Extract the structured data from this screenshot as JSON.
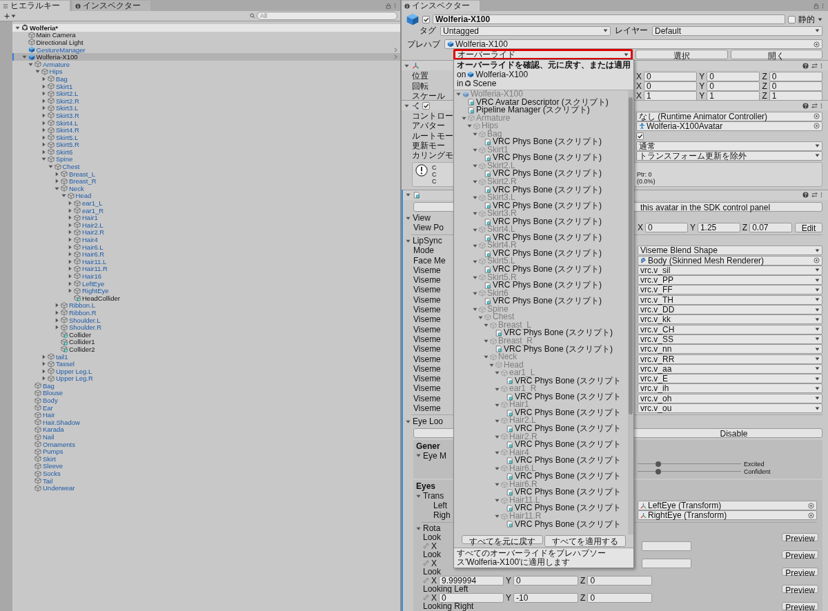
{
  "hierarchy": {
    "tabs": [
      {
        "label": "ヒエラルキー",
        "selected": true
      },
      {
        "label": "インスペクター",
        "selected": false
      }
    ],
    "add_button": "+",
    "search": {
      "placeholder": "All"
    },
    "tree": [
      {
        "name": "Wolferia*",
        "kind": "scene",
        "expanded": true,
        "selected": false,
        "children": [
          {
            "name": "Main Camera",
            "kind": "object",
            "selected": false
          },
          {
            "name": "Directional Light",
            "kind": "object",
            "selected": false
          },
          {
            "name": "GestureManager",
            "kind": "prefab",
            "selected": false
          },
          {
            "name": "Wolferia-X100",
            "kind": "prefab",
            "expanded": true,
            "selected": true,
            "children": [
              {
                "name": "Armature",
                "kind": "prefab-child",
                "expanded": true,
                "selected": false,
                "children": [
                  {
                    "name": "Hips",
                    "kind": "prefab-child",
                    "expanded": true,
                    "selected": false,
                    "children": [
                      {
                        "name": "Bag",
                        "kind": "prefab-child",
                        "expanded": false,
                        "selected": false
                      },
                      {
                        "name": "Skirt1",
                        "kind": "prefab-child",
                        "expanded": false,
                        "selected": false
                      },
                      {
                        "name": "Skirt2.L",
                        "kind": "prefab-child",
                        "expanded": false,
                        "selected": false
                      },
                      {
                        "name": "Skirt2.R",
                        "kind": "prefab-child",
                        "expanded": false,
                        "selected": false
                      },
                      {
                        "name": "Skirt3.L",
                        "kind": "prefab-child",
                        "expanded": false,
                        "selected": false
                      },
                      {
                        "name": "Skirt3.R",
                        "kind": "prefab-child",
                        "expanded": false,
                        "selected": false
                      },
                      {
                        "name": "Skirt4.L",
                        "kind": "prefab-child",
                        "expanded": false,
                        "selected": false
                      },
                      {
                        "name": "Skirt4.R",
                        "kind": "prefab-child",
                        "expanded": false,
                        "selected": false
                      },
                      {
                        "name": "Skirt5.L",
                        "kind": "prefab-child",
                        "expanded": false,
                        "selected": false
                      },
                      {
                        "name": "Skirt5.R",
                        "kind": "prefab-child",
                        "expanded": false,
                        "selected": false
                      },
                      {
                        "name": "Skirt6",
                        "kind": "prefab-child",
                        "expanded": false,
                        "selected": false
                      },
                      {
                        "name": "Spine",
                        "kind": "prefab-child",
                        "expanded": true,
                        "selected": false,
                        "children": [
                          {
                            "name": "Chest",
                            "kind": "prefab-child",
                            "expanded": true,
                            "selected": false,
                            "children": [
                              {
                                "name": "Breast_L",
                                "kind": "prefab-child",
                                "expanded": false,
                                "selected": false
                              },
                              {
                                "name": "Breast_R",
                                "kind": "prefab-child",
                                "expanded": false,
                                "selected": false
                              },
                              {
                                "name": "Neck",
                                "kind": "prefab-child",
                                "expanded": true,
                                "selected": false,
                                "children": [
                                  {
                                    "name": "Head",
                                    "kind": "prefab-child",
                                    "expanded": true,
                                    "selected": false,
                                    "children": [
                                      {
                                        "name": "ear1_L",
                                        "kind": "prefab-child",
                                        "expanded": false,
                                        "selected": false
                                      },
                                      {
                                        "name": "ear1_R",
                                        "kind": "prefab-child",
                                        "expanded": false,
                                        "selected": false
                                      },
                                      {
                                        "name": "Hair1",
                                        "kind": "prefab-child",
                                        "expanded": false,
                                        "selected": false
                                      },
                                      {
                                        "name": "Hair2.L",
                                        "kind": "prefab-child",
                                        "expanded": false,
                                        "selected": false
                                      },
                                      {
                                        "name": "Hair2.R",
                                        "kind": "prefab-child",
                                        "expanded": false,
                                        "selected": false
                                      },
                                      {
                                        "name": "Hair4",
                                        "kind": "prefab-child",
                                        "expanded": false,
                                        "selected": false
                                      },
                                      {
                                        "name": "Hair6.L",
                                        "kind": "prefab-child",
                                        "expanded": false,
                                        "selected": false
                                      },
                                      {
                                        "name": "Hair6.R",
                                        "kind": "prefab-child",
                                        "expanded": false,
                                        "selected": false
                                      },
                                      {
                                        "name": "Hair11.L",
                                        "kind": "prefab-child",
                                        "expanded": false,
                                        "selected": false
                                      },
                                      {
                                        "name": "Hair11.R",
                                        "kind": "prefab-child",
                                        "expanded": false,
                                        "selected": false
                                      },
                                      {
                                        "name": "Hair16",
                                        "kind": "prefab-child",
                                        "expanded": false,
                                        "selected": false
                                      },
                                      {
                                        "name": "LeftEye",
                                        "kind": "prefab-child",
                                        "expanded": false,
                                        "selected": false
                                      },
                                      {
                                        "name": "RightEye",
                                        "kind": "prefab-child",
                                        "expanded": false,
                                        "selected": false
                                      },
                                      {
                                        "name": "HeadCollider",
                                        "kind": "collider",
                                        "selected": false
                                      }
                                    ]
                                  }
                                ]
                              },
                              {
                                "name": "Ribbon.L",
                                "kind": "prefab-child",
                                "expanded": false,
                                "selected": false
                              },
                              {
                                "name": "Ribbon.R",
                                "kind": "prefab-child",
                                "expanded": false,
                                "selected": false
                              },
                              {
                                "name": "Shoulder.L",
                                "kind": "prefab-child",
                                "expanded": false,
                                "selected": false
                              },
                              {
                                "name": "Shoulder.R",
                                "kind": "prefab-child",
                                "expanded": false,
                                "selected": false
                              },
                              {
                                "name": "Collider",
                                "kind": "collider",
                                "selected": false
                              },
                              {
                                "name": "Collider1",
                                "kind": "collider",
                                "selected": false
                              },
                              {
                                "name": "Collider2",
                                "kind": "collider",
                                "selected": false
                              }
                            ]
                          }
                        ]
                      },
                      {
                        "name": "tail1",
                        "kind": "prefab-child",
                        "expanded": false,
                        "selected": false
                      },
                      {
                        "name": "Tassel",
                        "kind": "prefab-child",
                        "expanded": false,
                        "selected": false
                      },
                      {
                        "name": "Upper Leg.L",
                        "kind": "prefab-child",
                        "expanded": false,
                        "selected": false
                      },
                      {
                        "name": "Upper Leg.R",
                        "kind": "prefab-child",
                        "expanded": false,
                        "selected": false
                      }
                    ]
                  }
                ]
              },
              {
                "name": "Bag",
                "kind": "prefab-child",
                "selected": false
              },
              {
                "name": "Blouse",
                "kind": "prefab-child",
                "selected": false
              },
              {
                "name": "Body",
                "kind": "prefab-child",
                "selected": false
              },
              {
                "name": "Ear",
                "kind": "prefab-child",
                "selected": false
              },
              {
                "name": "Hair",
                "kind": "prefab-child",
                "selected": false
              },
              {
                "name": "Hair.Shadow",
                "kind": "prefab-child",
                "selected": false
              },
              {
                "name": "Karada",
                "kind": "prefab-child",
                "selected": false
              },
              {
                "name": "Nail",
                "kind": "prefab-child",
                "selected": false
              },
              {
                "name": "Ornaments",
                "kind": "prefab-child",
                "selected": false
              },
              {
                "name": "Pumps",
                "kind": "prefab-child",
                "selected": false
              },
              {
                "name": "Skirt",
                "kind": "prefab-child",
                "selected": false
              },
              {
                "name": "Sleeve",
                "kind": "prefab-child",
                "selected": false
              },
              {
                "name": "Socks",
                "kind": "prefab-child",
                "selected": false
              },
              {
                "name": "Tail",
                "kind": "prefab-child",
                "selected": false
              },
              {
                "name": "Underwear",
                "kind": "prefab-child",
                "selected": false
              }
            ]
          }
        ]
      }
    ]
  },
  "inspector": {
    "tab": {
      "label": "インスペクター",
      "selected": true
    },
    "object": {
      "active": true,
      "name": "Wolferia-X100",
      "static": false,
      "static_label": "静的",
      "tag_label": "タグ",
      "tag": "Untagged",
      "layer_label": "レイヤー",
      "layer": "Default"
    },
    "prefab": {
      "label": "プレハブ",
      "asset": "Wolferia-X100",
      "overrides": {
        "label": "オーバーライド",
        "highlighted": true
      },
      "select": "選択",
      "open": "開く"
    },
    "transform": {
      "expanded": true,
      "rows": [
        {
          "label": "位置",
          "fields": [
            {
              "axis": "X",
              "value": "0"
            },
            {
              "axis": "Y",
              "value": "0"
            },
            {
              "axis": "Z",
              "value": "0"
            }
          ]
        },
        {
          "label": "回転",
          "fields": [
            {
              "axis": "X",
              "value": "0"
            },
            {
              "axis": "Y",
              "value": "0"
            },
            {
              "axis": "Z",
              "value": "0"
            }
          ]
        },
        {
          "label": "スケール",
          "fields": [
            {
              "axis": "X",
              "value": "1"
            },
            {
              "axis": "Y",
              "value": "1"
            },
            {
              "axis": "Z",
              "value": "1"
            }
          ]
        }
      ]
    },
    "animator": {
      "expanded": true,
      "enabled": true,
      "rows": [
        {
          "label": "コントロー",
          "kind": "object",
          "value": "なし (Runtime Animator Controller)"
        },
        {
          "label": "アバター",
          "kind": "avatar",
          "value": "Wolferia-X100Avatar"
        },
        {
          "label": "ルートモー",
          "kind": "checkbox",
          "checked": true
        },
        {
          "label": "更新モー",
          "kind": "dropdown",
          "value": "通常"
        },
        {
          "label": "カリングモ",
          "kind": "dropdown",
          "value": "トランスフォーム更新を除外"
        }
      ],
      "info_left": [
        "C",
        "C",
        "C"
      ],
      "info_right": [
        "Ptr: 0",
        "(0.0%)"
      ]
    },
    "descriptor": {
      "expanded": true,
      "sdk_button": "this avatar in the SDK control panel",
      "view": {
        "title": "View",
        "expanded": true,
        "label": "View Po",
        "fields": [
          {
            "axis": "X",
            "value": "0"
          },
          {
            "axis": "Y",
            "value": "1.25"
          },
          {
            "axis": "Z",
            "value": "0.07"
          }
        ],
        "edit": "Edit"
      },
      "lipsync": {
        "title": "LipSync",
        "expanded": true,
        "rows": [
          {
            "label": "Mode",
            "kind": "dropdown",
            "value": "Viseme Blend Shape"
          },
          {
            "label": "Face Me",
            "kind": "mesh",
            "value": "Body (Skinned Mesh Renderer)"
          },
          {
            "label": "Viseme",
            "kind": "dropdown",
            "value": "vrc.v_sil"
          },
          {
            "label": "Viseme",
            "kind": "dropdown",
            "value": "vrc.v_PP"
          },
          {
            "label": "Viseme",
            "kind": "dropdown",
            "value": "vrc.v_FF"
          },
          {
            "label": "Viseme",
            "kind": "dropdown",
            "value": "vrc.v_TH"
          },
          {
            "label": "Viseme",
            "kind": "dropdown",
            "value": "vrc.v_DD"
          },
          {
            "label": "Viseme",
            "kind": "dropdown",
            "value": "vrc.v_kk"
          },
          {
            "label": "Viseme",
            "kind": "dropdown",
            "value": "vrc.v_CH"
          },
          {
            "label": "Viseme",
            "kind": "dropdown",
            "value": "vrc.v_SS"
          },
          {
            "label": "Viseme",
            "kind": "dropdown",
            "value": "vrc.v_nn"
          },
          {
            "label": "Viseme",
            "kind": "dropdown",
            "value": "vrc.v_RR"
          },
          {
            "label": "Viseme",
            "kind": "dropdown",
            "value": "vrc.v_aa"
          },
          {
            "label": "Viseme",
            "kind": "dropdown",
            "value": "vrc.v_E"
          },
          {
            "label": "Viseme",
            "kind": "dropdown",
            "value": "vrc.v_ih"
          },
          {
            "label": "Viseme",
            "kind": "dropdown",
            "value": "vrc.v_oh"
          },
          {
            "label": "Viseme",
            "kind": "dropdown",
            "value": "vrc.v_ou"
          }
        ]
      },
      "eye_look": {
        "title": "Eye Loo",
        "expanded": true,
        "button": "Disable",
        "general": {
          "title": "Gener",
          "fold": "Eye M",
          "expanded": true,
          "sliders": [
            {
              "label": "Excited",
              "level": 0.2
            },
            {
              "label": "Confident",
              "level": 0.2
            }
          ]
        },
        "eyes": {
          "title": "Eyes",
          "fold": "Trans",
          "expanded": true,
          "rows": [
            {
              "label": "Left",
              "value": "LeftEye (Transform)"
            },
            {
              "label": "Righ",
              "value": "RightEye (Transform)"
            }
          ],
          "rotations": {
            "title": "Rota",
            "expanded": true,
            "items": [
              {
                "label": "Look",
                "preview": "Preview",
                "kind": "covered",
                "fields": [
                  {
                    "axis": "X"
                  }
                ]
              },
              {
                "label": "Look",
                "preview": "Preview",
                "kind": "covered",
                "fields": [
                  {
                    "axis": "X"
                  }
                ]
              },
              {
                "label": "Look",
                "preview": "Preview",
                "kind": "full",
                "fields": [
                  {
                    "axis": "X",
                    "value": "9.999994"
                  },
                  {
                    "axis": "Y",
                    "value": "0"
                  },
                  {
                    "axis": "Z",
                    "value": "0"
                  }
                ]
              },
              {
                "label": "Looking Left",
                "preview": "Preview",
                "kind": "full",
                "fields": [
                  {
                    "axis": "X",
                    "value": "0"
                  },
                  {
                    "axis": "Y",
                    "value": "-10"
                  },
                  {
                    "axis": "Z",
                    "value": "0"
                  }
                ]
              },
              {
                "label": "Looking Right",
                "preview": "Preview",
                "kind": "label"
              }
            ]
          }
        }
      }
    }
  },
  "override_popup": {
    "title": "オーバーライドを確認、元に戻す、または適用",
    "on_label": "on",
    "target": "Wolferia-X100",
    "in_label": "in",
    "scene": "Scene",
    "tree": [
      {
        "name": "Wolferia-X100",
        "kind": "prefab",
        "expanded": true,
        "children": [
          {
            "name": "VRC Avatar Descriptor (スクリプト)",
            "kind": "component"
          },
          {
            "name": "Pipeline Manager (スクリプト)",
            "kind": "component"
          },
          {
            "name": "Armature",
            "kind": "object",
            "expanded": true,
            "children": [
              {
                "name": "Hips",
                "kind": "object",
                "expanded": true,
                "children": [
                  {
                    "name": "Bag",
                    "kind": "object",
                    "expanded": true,
                    "children": [
                      {
                        "name": "VRC Phys Bone (スクリプト)",
                        "kind": "component"
                      }
                    ]
                  },
                  {
                    "name": "Skirt1",
                    "kind": "object",
                    "expanded": true,
                    "children": [
                      {
                        "name": "VRC Phys Bone (スクリプト)",
                        "kind": "component"
                      }
                    ]
                  },
                  {
                    "name": "Skirt2.L",
                    "kind": "object",
                    "expanded": true,
                    "children": [
                      {
                        "name": "VRC Phys Bone (スクリプト)",
                        "kind": "component"
                      }
                    ]
                  },
                  {
                    "name": "Skirt2.R",
                    "kind": "object",
                    "expanded": true,
                    "children": [
                      {
                        "name": "VRC Phys Bone (スクリプト)",
                        "kind": "component"
                      }
                    ]
                  },
                  {
                    "name": "Skirt3.L",
                    "kind": "object",
                    "expanded": true,
                    "children": [
                      {
                        "name": "VRC Phys Bone (スクリプト)",
                        "kind": "component"
                      }
                    ]
                  },
                  {
                    "name": "Skirt3.R",
                    "kind": "object",
                    "expanded": true,
                    "children": [
                      {
                        "name": "VRC Phys Bone (スクリプト)",
                        "kind": "component"
                      }
                    ]
                  },
                  {
                    "name": "Skirt4.L",
                    "kind": "object",
                    "expanded": true,
                    "children": [
                      {
                        "name": "VRC Phys Bone (スクリプト)",
                        "kind": "component"
                      }
                    ]
                  },
                  {
                    "name": "Skirt4.R",
                    "kind": "object",
                    "expanded": true,
                    "children": [
                      {
                        "name": "VRC Phys Bone (スクリプト)",
                        "kind": "component"
                      }
                    ]
                  },
                  {
                    "name": "Skirt5.L",
                    "kind": "object",
                    "expanded": true,
                    "children": [
                      {
                        "name": "VRC Phys Bone (スクリプト)",
                        "kind": "component"
                      }
                    ]
                  },
                  {
                    "name": "Skirt5.R",
                    "kind": "object",
                    "expanded": true,
                    "children": [
                      {
                        "name": "VRC Phys Bone (スクリプト)",
                        "kind": "component"
                      }
                    ]
                  },
                  {
                    "name": "Skirt6",
                    "kind": "object",
                    "expanded": true,
                    "children": [
                      {
                        "name": "VRC Phys Bone (スクリプト)",
                        "kind": "component"
                      }
                    ]
                  },
                  {
                    "name": "Spine",
                    "kind": "object",
                    "expanded": true,
                    "children": [
                      {
                        "name": "Chest",
                        "kind": "object",
                        "expanded": true,
                        "children": [
                          {
                            "name": "Breast_L",
                            "kind": "object",
                            "expanded": true,
                            "children": [
                              {
                                "name": "VRC Phys Bone (スクリプト)",
                                "kind": "component"
                              }
                            ]
                          },
                          {
                            "name": "Breast_R",
                            "kind": "object",
                            "expanded": true,
                            "children": [
                              {
                                "name": "VRC Phys Bone (スクリプト)",
                                "kind": "component"
                              }
                            ]
                          },
                          {
                            "name": "Neck",
                            "kind": "object",
                            "expanded": true,
                            "children": [
                              {
                                "name": "Head",
                                "kind": "object",
                                "expanded": true,
                                "children": [
                                  {
                                    "name": "ear1_L",
                                    "kind": "object",
                                    "expanded": true,
                                    "children": [
                                      {
                                        "name": "VRC Phys Bone (スクリプト",
                                        "kind": "component"
                                      }
                                    ]
                                  },
                                  {
                                    "name": "ear1_R",
                                    "kind": "object",
                                    "expanded": true,
                                    "children": [
                                      {
                                        "name": "VRC Phys Bone (スクリプト",
                                        "kind": "component"
                                      }
                                    ]
                                  },
                                  {
                                    "name": "Hair1",
                                    "kind": "object",
                                    "expanded": true,
                                    "children": [
                                      {
                                        "name": "VRC Phys Bone (スクリプト",
                                        "kind": "component"
                                      }
                                    ]
                                  },
                                  {
                                    "name": "Hair2.L",
                                    "kind": "object",
                                    "expanded": true,
                                    "children": [
                                      {
                                        "name": "VRC Phys Bone (スクリプト",
                                        "kind": "component"
                                      }
                                    ]
                                  },
                                  {
                                    "name": "Hair2.R",
                                    "kind": "object",
                                    "expanded": true,
                                    "children": [
                                      {
                                        "name": "VRC Phys Bone (スクリプト",
                                        "kind": "component"
                                      }
                                    ]
                                  },
                                  {
                                    "name": "Hair4",
                                    "kind": "object",
                                    "expanded": true,
                                    "children": [
                                      {
                                        "name": "VRC Phys Bone (スクリプト",
                                        "kind": "component"
                                      }
                                    ]
                                  },
                                  {
                                    "name": "Hair6.L",
                                    "kind": "object",
                                    "expanded": true,
                                    "children": [
                                      {
                                        "name": "VRC Phys Bone (スクリプト",
                                        "kind": "component"
                                      }
                                    ]
                                  },
                                  {
                                    "name": "Hair6.R",
                                    "kind": "object",
                                    "expanded": true,
                                    "children": [
                                      {
                                        "name": "VRC Phys Bone (スクリプト",
                                        "kind": "component"
                                      }
                                    ]
                                  },
                                  {
                                    "name": "Hair11.L",
                                    "kind": "object",
                                    "expanded": true,
                                    "children": [
                                      {
                                        "name": "VRC Phys Bone (スクリプト",
                                        "kind": "component"
                                      }
                                    ]
                                  },
                                  {
                                    "name": "Hair11.R",
                                    "kind": "object",
                                    "expanded": true,
                                    "children": [
                                      {
                                        "name": "VRC Phys Bone (スクリプト",
                                        "kind": "component"
                                      }
                                    ]
                                  }
                                ]
                              }
                            ]
                          }
                        ]
                      }
                    ]
                  }
                ]
              }
            ]
          }
        ]
      }
    ],
    "revert": {
      "label": "すべてを元に戻す",
      "highlighted": false
    },
    "apply": {
      "label": "すべてを適用する",
      "highlighted": true
    },
    "tooltip": "すべてのオーバーライドをプレハブソース'Wolferia-X100'に適用します"
  }
}
